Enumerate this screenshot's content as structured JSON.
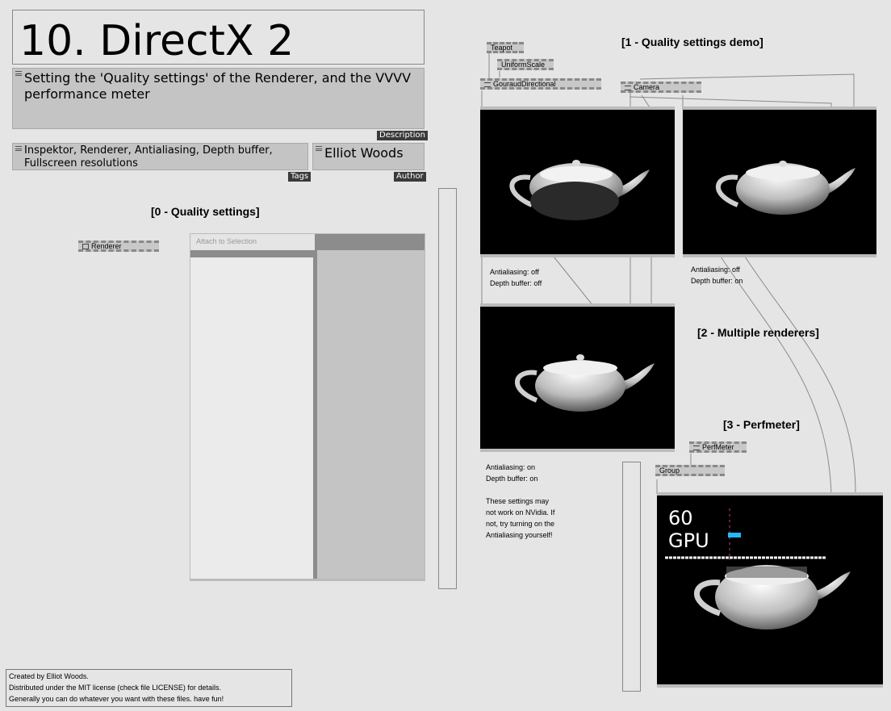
{
  "title": "10. DirectX 2",
  "description": {
    "text": "Setting the 'Quality settings' of the Renderer, and the VVVV performance meter",
    "label": "Description"
  },
  "tags": {
    "text": "Inspektor, Renderer, Antialiasing, Depth buffer, Fullscreen resolutions",
    "label": "Tags"
  },
  "author": {
    "text": "Elliot Woods",
    "label": "Author"
  },
  "sections": {
    "quality": "[0 - Quality settings]",
    "demo": "[1 - Quality settings demo]",
    "multi": "[2 - Multiple renderers]",
    "perf": "[3 - Perfmeter]"
  },
  "nodes": {
    "renderer": "Renderer",
    "teapot": "Teapot",
    "uniformscale": "UniformScale",
    "gouraud": "GouraudDirectional",
    "camera": "Camera",
    "perfmeter": "PerfMeter",
    "group": "Group"
  },
  "inspector": {
    "placeholder": "Attach to Selection"
  },
  "notes": {
    "r1": "Antialiasing: off\nDepth buffer: off",
    "r2": "Antialiasing: off\nDepth buffer: on",
    "r3": "Antialiasing: on\nDepth buffer: on\n\nThese settings may\nnot work on NVidia. If\nnot, try turning on the\nAntialiasing yourself!"
  },
  "perfmeter_overlay": {
    "fps": "60",
    "gpu": "GPU"
  },
  "credits": [
    "Created by Elliot Woods.",
    "Distributed under the MIT license (check file LICENSE) for details.",
    "Generally you can do whatever you want with these files. have fun!"
  ],
  "colors": {
    "background": "#e5e5e5",
    "ibox": "#c4c4c4",
    "render_bg": "#000000",
    "gpu_bar": "#29b6f6"
  }
}
